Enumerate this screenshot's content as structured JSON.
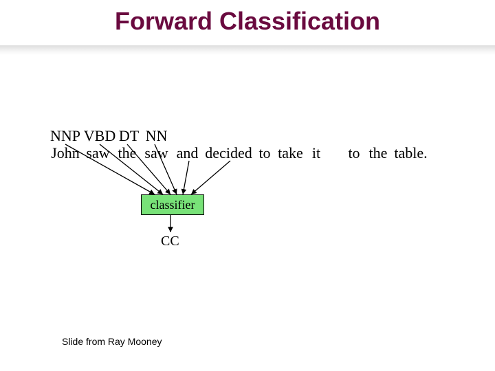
{
  "title": "Forward Classification",
  "tags": {
    "nnp": "NNP",
    "vbd": "VBD",
    "dt": "DT",
    "nn": "NN"
  },
  "tokens": {
    "john": "John",
    "saw1": "saw",
    "the1": "the",
    "saw2": "saw",
    "and": "and",
    "decided": "decided",
    "to1": "to",
    "take": "take",
    "it": "it",
    "to2": "to",
    "the2": "the",
    "table": "table."
  },
  "classifier_label": "classifier",
  "output_tag": "CC",
  "credit": "Slide from Ray Mooney"
}
